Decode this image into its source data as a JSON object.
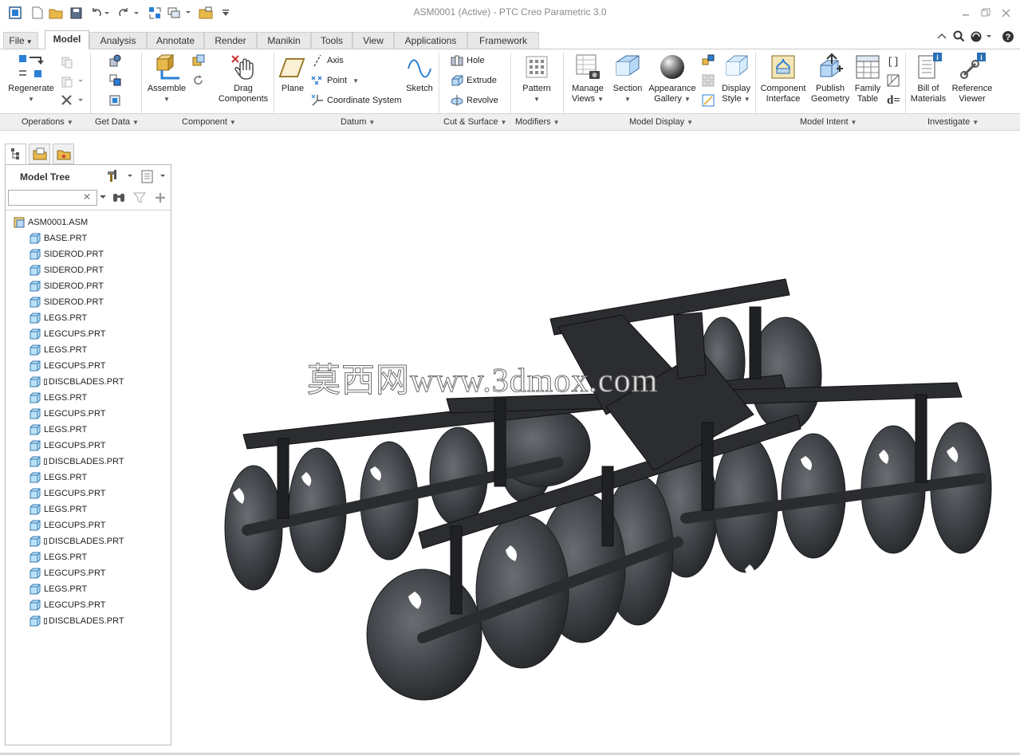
{
  "window": {
    "title": "ASM0001 (Active) - PTC Creo Parametric 3.0"
  },
  "tabs": [
    {
      "label": "File",
      "has_menu": true
    },
    {
      "label": "Model",
      "active": true
    },
    {
      "label": "Analysis"
    },
    {
      "label": "Annotate"
    },
    {
      "label": "Render"
    },
    {
      "label": "Manikin"
    },
    {
      "label": "Tools"
    },
    {
      "label": "View"
    },
    {
      "label": "Applications"
    },
    {
      "label": "Framework"
    }
  ],
  "ribbon": {
    "regenerate": "Regenerate",
    "assemble": "Assemble",
    "drag_1": "Drag",
    "drag_2": "Components",
    "plane": "Plane",
    "axis": "Axis",
    "point": "Point",
    "coord_sys": "Coordinate System",
    "sketch": "Sketch",
    "hole": "Hole",
    "extrude": "Extrude",
    "revolve": "Revolve",
    "pattern": "Pattern",
    "manage_views_1": "Manage",
    "manage_views_2": "Views",
    "section": "Section",
    "appearance_1": "Appearance",
    "appearance_2": "Gallery",
    "display_style_1": "Display",
    "display_style_2": "Style",
    "comp_interface_1": "Component",
    "comp_interface_2": "Interface",
    "publish_1": "Publish",
    "publish_2": "Geometry",
    "family_1": "Family",
    "family_2": "Table",
    "relations_label": "d=",
    "bom_1": "Bill of",
    "bom_2": "Materials",
    "ref_viewer_1": "Reference",
    "ref_viewer_2": "Viewer"
  },
  "groups": [
    "Operations",
    "Get Data",
    "Component",
    "Datum",
    "Cut & Surface",
    "Modifiers",
    "Model Display",
    "Model Intent",
    "Investigate"
  ],
  "model_tree": {
    "title": "Model Tree",
    "search_value": "",
    "root": "ASM0001.ASM",
    "items": [
      "BASE.PRT",
      "SIDEROD.PRT",
      "SIDEROD.PRT",
      "SIDEROD.PRT",
      "SIDEROD.PRT",
      "LEGS.PRT",
      "LEGCUPS.PRT",
      "LEGS.PRT",
      "LEGCUPS.PRT",
      "DISCBLADES.PRT",
      "LEGS.PRT",
      "LEGCUPS.PRT",
      "LEGS.PRT",
      "LEGCUPS.PRT",
      "DISCBLADES.PRT",
      "LEGS.PRT",
      "LEGCUPS.PRT",
      "LEGS.PRT",
      "LEGCUPS.PRT",
      "DISCBLADES.PRT",
      "LEGS.PRT",
      "LEGCUPS.PRT",
      "LEGS.PRT",
      "LEGCUPS.PRT",
      "DISCBLADES.PRT"
    ]
  },
  "watermark": "莫西网www.3dmox.com",
  "colors": {
    "accent": "#2a7fd4",
    "model": "#2e3033",
    "ribbon_group_bg": "#efefef"
  }
}
